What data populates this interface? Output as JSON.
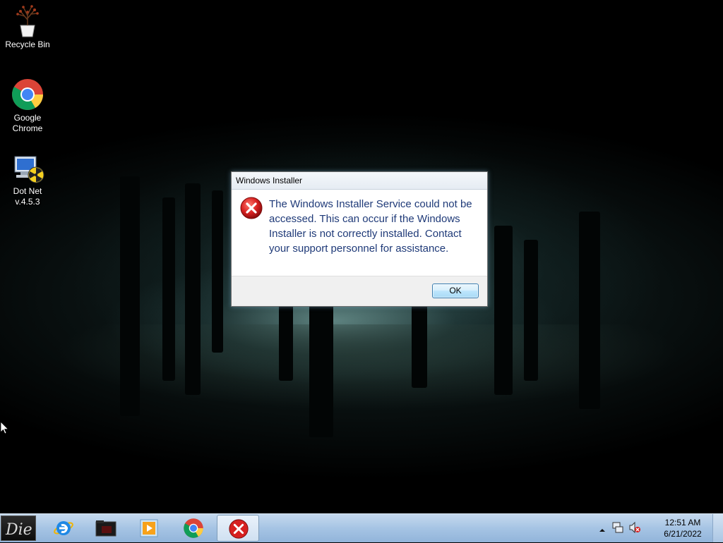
{
  "desktop": {
    "icons": [
      {
        "label_line1": "Recycle Bin",
        "label_line2": "",
        "icon": "recycle-bin-icon"
      },
      {
        "label_line1": "Google",
        "label_line2": "Chrome",
        "icon": "chrome-icon"
      },
      {
        "label_line1": "Dot Net",
        "label_line2": "v.4.5.3",
        "icon": "dotnet-installer-icon"
      }
    ]
  },
  "dialog": {
    "title": "Windows Installer",
    "icon": "error-icon",
    "message": "The Windows Installer Service could not be accessed. This can occur if the Windows Installer is not correctly installed. Contact your support personnel for assistance.",
    "ok_label": "OK"
  },
  "taskbar": {
    "start_label": "Die",
    "pinned": [
      {
        "name": "internet-explorer-icon"
      },
      {
        "name": "file-explorer-icon"
      },
      {
        "name": "media-player-icon"
      },
      {
        "name": "chrome-icon"
      },
      {
        "name": "error-icon",
        "active": true
      }
    ],
    "tray": {
      "time": "12:51 AM",
      "date": "6/21/2022",
      "icons": [
        "show-hidden-icons-icon",
        "network-icon",
        "volume-muted-icon"
      ]
    }
  },
  "colors": {
    "dialog_text": "#1f3a78",
    "error_red": "#d62020",
    "taskbar": "#a6c4e4"
  }
}
